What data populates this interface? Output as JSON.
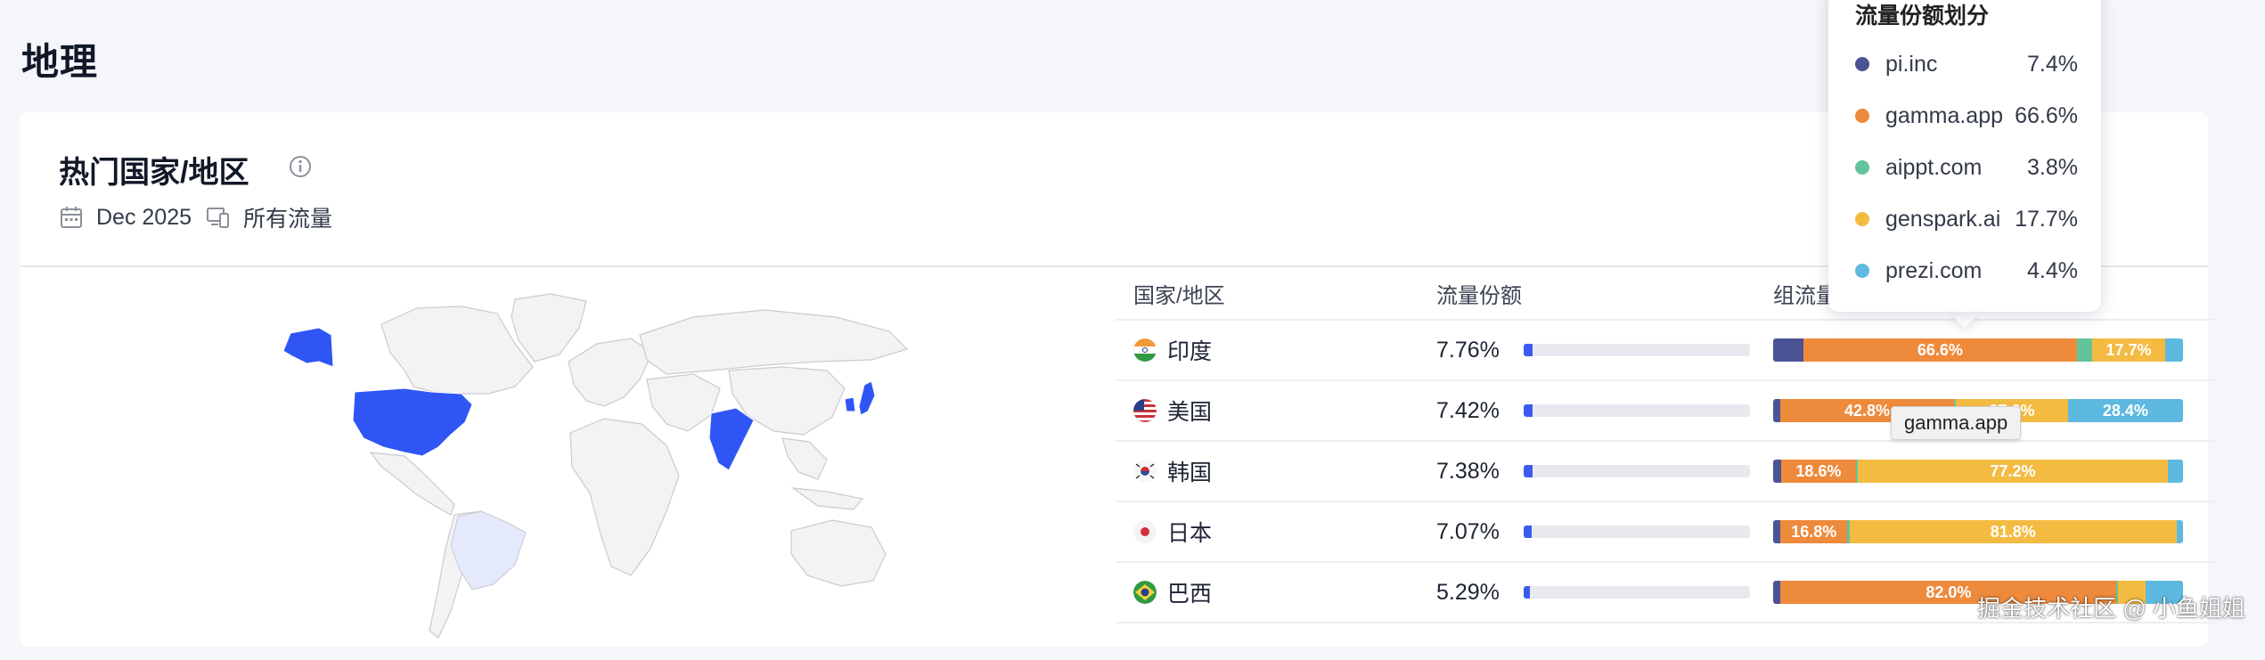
{
  "page": {
    "title": "地理"
  },
  "card": {
    "title": "热门国家/地区",
    "date": "Dec 2025",
    "traffic": "所有流量"
  },
  "table": {
    "headers": [
      "国家/地区",
      "流量份额",
      "组流量份额"
    ],
    "rows": [
      {
        "country": "印度",
        "share": "7.76%",
        "share_value": 7.76,
        "segments": [
          {
            "label": "",
            "pct": 7.4
          },
          {
            "label": "66.6%",
            "pct": 66.6
          },
          {
            "label": "",
            "pct": 3.8
          },
          {
            "label": "17.7%",
            "pct": 17.7
          },
          {
            "label": "",
            "pct": 4.4
          }
        ]
      },
      {
        "country": "美国",
        "share": "7.42%",
        "share_value": 7.42,
        "segments": [
          {
            "label": "",
            "pct": 1.8
          },
          {
            "label": "42.8%",
            "pct": 42.8
          },
          {
            "label": "",
            "pct": 0.5
          },
          {
            "label": "27.6%",
            "pct": 27.6
          },
          {
            "label": "28.4%",
            "pct": 28.4
          }
        ]
      },
      {
        "country": "韩国",
        "share": "7.38%",
        "share_value": 7.38,
        "segments": [
          {
            "label": "",
            "pct": 2.0
          },
          {
            "label": "18.6%",
            "pct": 18.6
          },
          {
            "label": "",
            "pct": 0.5
          },
          {
            "label": "77.2%",
            "pct": 77.2
          },
          {
            "label": "",
            "pct": 3.8
          }
        ]
      },
      {
        "country": "日本",
        "share": "7.07%",
        "share_value": 7.07,
        "segments": [
          {
            "label": "",
            "pct": 1.8
          },
          {
            "label": "16.8%",
            "pct": 16.8
          },
          {
            "label": "",
            "pct": 0.5
          },
          {
            "label": "81.8%",
            "pct": 81.8
          },
          {
            "label": "",
            "pct": 1.6
          }
        ]
      },
      {
        "country": "巴西",
        "share": "5.29%",
        "share_value": 5.29,
        "segments": [
          {
            "label": "",
            "pct": 1.8
          },
          {
            "label": "82.0%",
            "pct": 82.0
          },
          {
            "label": "",
            "pct": 0.3
          },
          {
            "label": "",
            "pct": 6.7
          },
          {
            "label": "",
            "pct": 9.2
          }
        ]
      }
    ]
  },
  "tooltip": {
    "title": "流量份额划分",
    "items": [
      {
        "name": "pi.inc",
        "value": "7.4%",
        "color": "#4a5394"
      },
      {
        "name": "gamma.app",
        "value": "66.6%",
        "color": "#ee8a3c"
      },
      {
        "name": "aippt.com",
        "value": "3.8%",
        "color": "#62c49b"
      },
      {
        "name": "genspark.ai",
        "value": "17.7%",
        "color": "#f4bb42"
      },
      {
        "name": "prezi.com",
        "value": "4.4%",
        "color": "#5db9df"
      }
    ]
  },
  "hover_tip": "gamma.app",
  "colors": {
    "accent": "#3b5bef",
    "map_highlight": "#2f56f5",
    "map_light": "#e4e9fb",
    "map_land": "#f3f3f3"
  },
  "watermark": "掘金技术社区 @ 小鱼姐姐"
}
